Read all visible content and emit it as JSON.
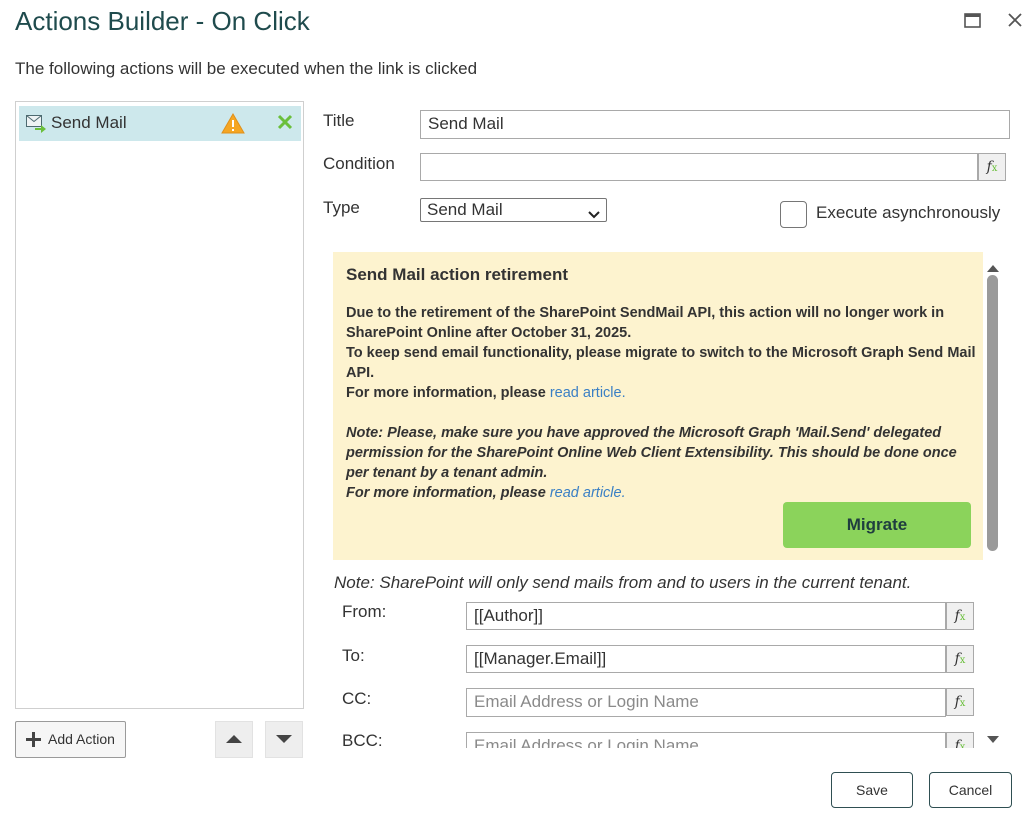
{
  "dialog": {
    "title": "Actions Builder - On Click",
    "maximize_icon": "maximize-icon",
    "close_icon": "close-icon"
  },
  "subtitle": "The following actions will be executed when the link is clicked",
  "actions": {
    "items": [
      {
        "label": "Send Mail",
        "icon": "mail-send-icon",
        "warning_icon": "warning-icon",
        "delete_icon": "delete-x-icon"
      }
    ],
    "add_label": "Add Action",
    "move_up_icon": "move-up-icon",
    "move_down_icon": "move-down-icon"
  },
  "form": {
    "title_label": "Title",
    "title_value": "Send Mail",
    "condition_label": "Condition",
    "condition_value": "",
    "type_label": "Type",
    "type_value": "Send Mail",
    "async_label": "Execute asynchronously",
    "async_checked": false,
    "fx_label": "f"
  },
  "notice": {
    "heading": "Send Mail action retirement",
    "line1": "Due to the retirement of the SharePoint SendMail API, this action will no longer work in SharePoint Online after October 31, 2025.",
    "line2": "To keep send email functionality, please migrate to switch to the Microsoft Graph Send Mail API.",
    "more_prefix": "For more information, please ",
    "link_text": "read article.",
    "note_text": "Note: Please, make sure you have approved the Microsoft Graph 'Mail.Send' delegated permission for the SharePoint Online Web Client Extensibility. This should be done once per tenant by a tenant admin.",
    "migrate_label": "Migrate",
    "background_color": "#fdf3cf",
    "button_color": "#8bd35b"
  },
  "mail": {
    "tenant_note": "Note: SharePoint will only send mails from and to users in the current tenant.",
    "from_label": "From:",
    "from_value": "[[Author]]",
    "to_label": "To:",
    "to_value": "[[Manager.Email]]",
    "cc_label": "CC:",
    "cc_placeholder": "Email Address or Login Name",
    "bcc_label": "BCC:",
    "bcc_placeholder": "Email Address or Login Name"
  },
  "footer": {
    "save_label": "Save",
    "cancel_label": "Cancel"
  },
  "colors": {
    "title": "#1f4b4d",
    "selected_item": "#cde8ec",
    "link": "#3a7fc4"
  }
}
